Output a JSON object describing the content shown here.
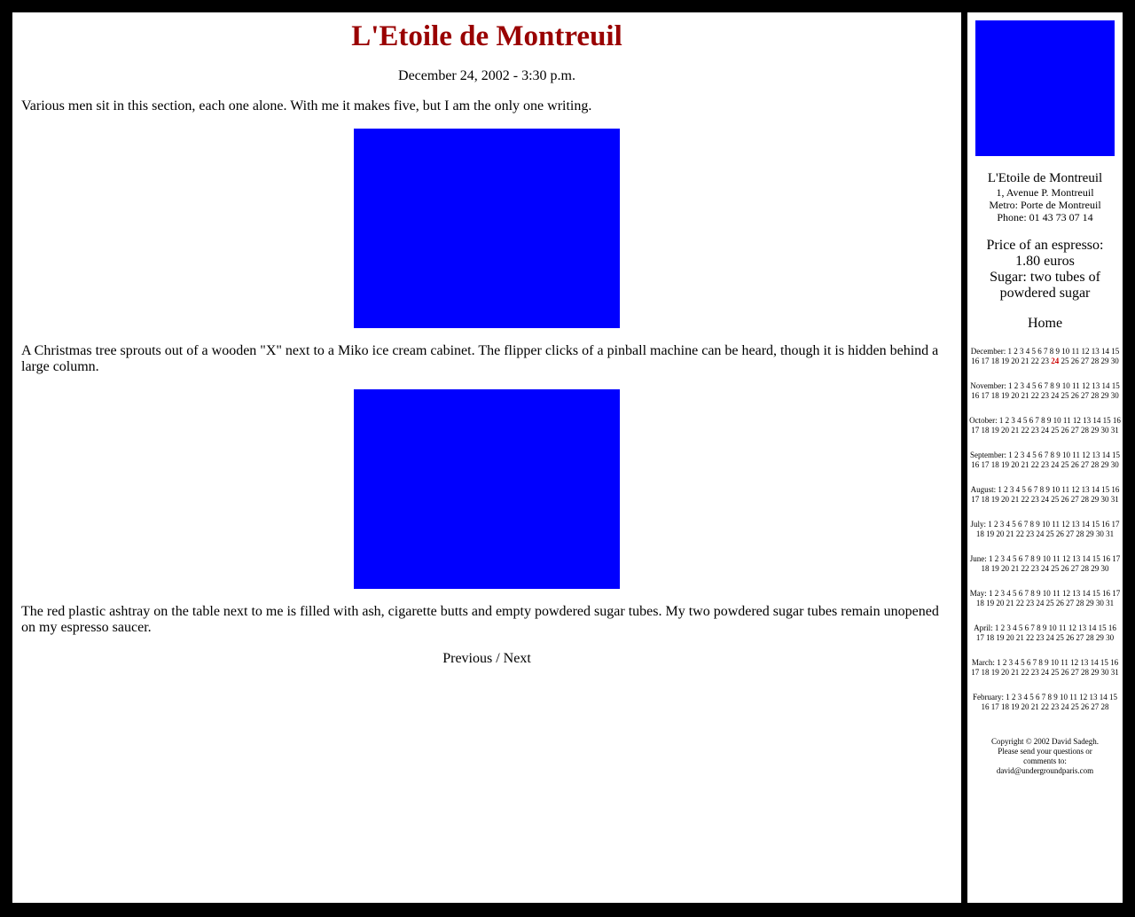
{
  "article": {
    "title": "L'Etoile de Montreuil",
    "date": "December 24, 2002 - 3:30 p.m.",
    "paragraphs": [
      "Various men sit in this section, each one alone. With me it makes five, but I am the only one writing.",
      "A Christmas tree sprouts out of a wooden \"X\" next to a Miko ice cream cabinet. The flipper clicks of a pinball machine can be heard, though it is hidden behind a large column.",
      "The red plastic ashtray on the table next to me is filled with ash, cigarette butts and empty powdered sugar tubes. My two powdered sugar tubes remain unopened on my espresso saucer."
    ],
    "nav": {
      "previous": "Previous",
      "separator": " / ",
      "next": "Next"
    }
  },
  "sidebar": {
    "cafe_name": "L'Etoile de Montreuil",
    "address_lines": [
      "1, Avenue P. Montreuil",
      "Metro: Porte de Montreuil",
      "Phone: 01 43 73 07 14"
    ],
    "price_lines": [
      "Price of an espresso:",
      "1.80 euros",
      "Sugar: two tubes of",
      "powdered sugar"
    ],
    "home_label": "Home",
    "archive": [
      {
        "month": "December:",
        "days": 30,
        "current": 24
      },
      {
        "month": "November:",
        "days": 30
      },
      {
        "month": "October:",
        "days": 31
      },
      {
        "month": "September:",
        "days": 30
      },
      {
        "month": "August:",
        "days": 31
      },
      {
        "month": "July:",
        "days": 31
      },
      {
        "month": "June:",
        "days": 30
      },
      {
        "month": "May:",
        "days": 31
      },
      {
        "month": "April:",
        "days": 30
      },
      {
        "month": "March:",
        "days": 31
      },
      {
        "month": "February:",
        "days": 28
      }
    ],
    "copyright_lines": [
      "Copyright © 2002 David Sadegh.",
      "Please send your questions or",
      "comments to:",
      "david@undergroundparis.com"
    ]
  },
  "colors": {
    "background": "#000000",
    "panel": "#ffffff",
    "title": "#990000",
    "photo_placeholder": "#0000ff",
    "current_day": "#cc0000"
  }
}
